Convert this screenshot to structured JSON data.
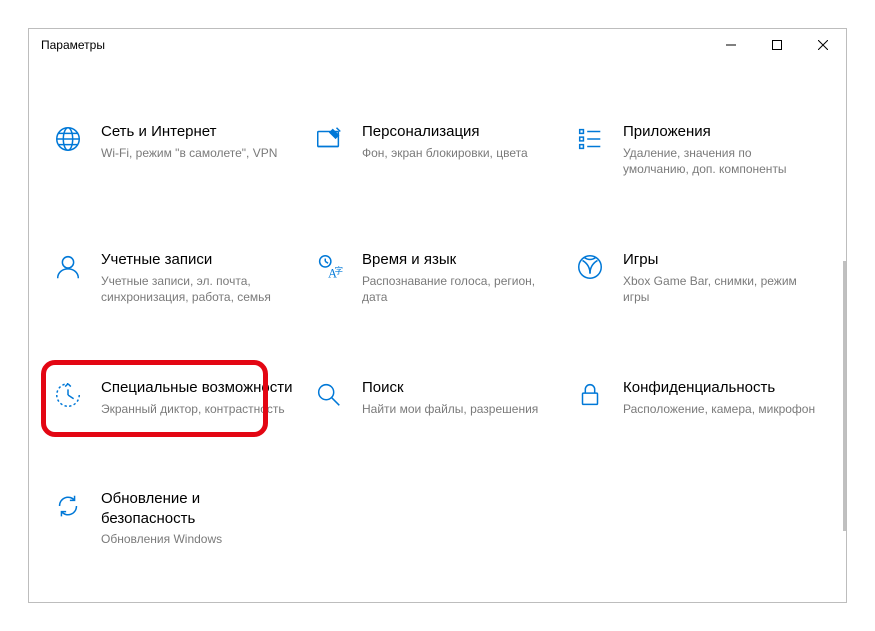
{
  "window": {
    "title": "Параметры"
  },
  "tiles": [
    {
      "title": "Сеть и Интернет",
      "sub": "Wi-Fi, режим \"в самолете\", VPN"
    },
    {
      "title": "Персонализация",
      "sub": "Фон, экран блокировки, цвета"
    },
    {
      "title": "Приложения",
      "sub": "Удаление, значения по умолчанию, доп. компоненты"
    },
    {
      "title": "Учетные записи",
      "sub": "Учетные записи, эл. почта, синхронизация, работа, семья"
    },
    {
      "title": "Время и язык",
      "sub": "Распознавание голоса, регион, дата"
    },
    {
      "title": "Игры",
      "sub": "Xbox Game Bar, снимки, режим игры"
    },
    {
      "title": "Специальные возможности",
      "sub": "Экранный диктор, контрастность"
    },
    {
      "title": "Поиск",
      "sub": "Найти мои файлы, разрешения"
    },
    {
      "title": "Конфиденциальность",
      "sub": "Расположение, камера, микрофон"
    },
    {
      "title": "Обновление и безопасность",
      "sub": "Обновления Windows"
    }
  ]
}
